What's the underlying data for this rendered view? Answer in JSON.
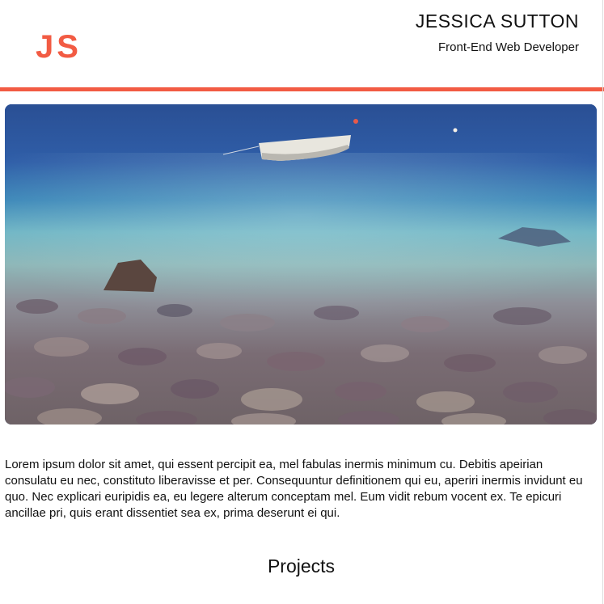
{
  "header": {
    "logo_text": "JS",
    "name": "JESSICA SUTTON",
    "role": "Front-End Web Developer"
  },
  "hero": {
    "image_alt": "Boat on clear sea water over rocks"
  },
  "main": {
    "intro_text": "Lorem ipsum dolor sit amet, qui essent percipit ea, mel fabulas inermis minimum cu. Debitis apeirian consulatu eu nec, constituto liberavisse et per. Consequuntur definitionem qui eu, aperiri inermis invidunt eu quo. Nec explicari euripidis ea, eu legere alterum conceptam mel. Eum vidit rebum vocent ex. Te epicuri ancillae pri, quis erant dissentiet sea ex, prima deserunt ei qui.",
    "projects_heading": "Projects"
  },
  "colors": {
    "accent": "#f25b43",
    "text": "#111111",
    "background": "#ffffff"
  }
}
